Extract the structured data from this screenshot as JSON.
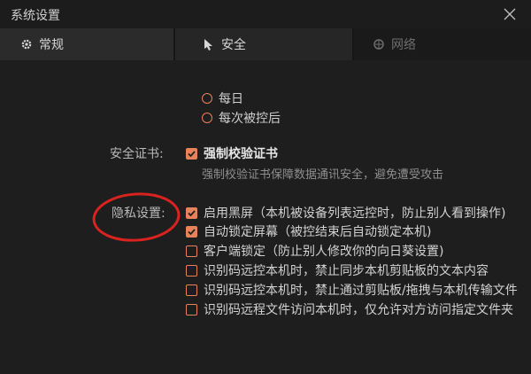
{
  "window": {
    "title": "系统设置",
    "close_icon": "close-icon"
  },
  "tabs": [
    {
      "label": "常规",
      "icon": "gear-icon"
    },
    {
      "label": "安全",
      "icon": "cursor-icon"
    },
    {
      "label": "网络",
      "icon": "globe-icon"
    }
  ],
  "remote_unlock": {
    "options": [
      {
        "label": "每日",
        "selected": false
      },
      {
        "label": "每次被控后",
        "selected": false
      }
    ]
  },
  "cert": {
    "label": "安全证书:",
    "checkbox_label": "强制校验证书",
    "checked": true,
    "description": "强制校验证书保障数据通讯安全，避免遭受攻击"
  },
  "privacy": {
    "label": "隐私设置:",
    "items": [
      {
        "label": "启用黑屏（本机被设备列表远控时，防止别人看到操作)",
        "checked": true
      },
      {
        "label": "自动锁定屏幕（被控结束后自动锁定本机)",
        "checked": true
      },
      {
        "label": "客户端锁定（防止别人修改你的向日葵设置)",
        "checked": false
      },
      {
        "label": "识别码远控本机时，禁止同步本机剪贴板的文本内容",
        "checked": false
      },
      {
        "label": "识别码远控本机时，禁止通过剪贴板/拖拽与本机传输文件",
        "checked": false
      },
      {
        "label": "识别码远程文件访问本机时，仅允许对方访问指定文件夹",
        "checked": false
      }
    ]
  },
  "colors": {
    "accent": "#e8825a",
    "annotation": "#d8231f",
    "background": "#1e1e1e"
  }
}
